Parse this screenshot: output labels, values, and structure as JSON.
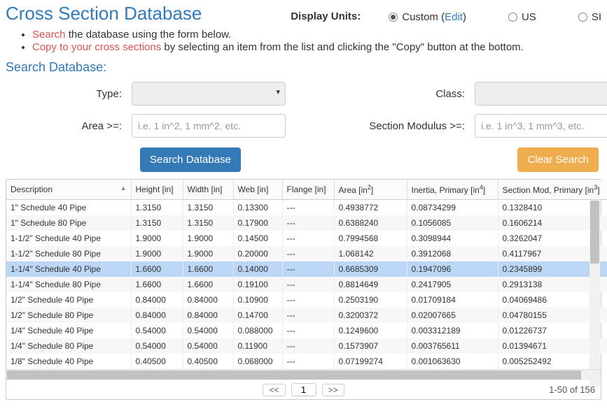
{
  "title": "Cross Section Database",
  "units_label": "Display Units:",
  "units": {
    "custom": "Custom",
    "edit": "Edit",
    "us": "US",
    "si": "SI"
  },
  "instructions": {
    "search_lead": "Search",
    "search_rest": " the database using the form below.",
    "copy_lead": "Copy to your cross sections",
    "copy_rest": " by selecting an item from the list and clicking the \"Copy\" button at the bottom."
  },
  "search_heading": "Search Database:",
  "form": {
    "type_label": "Type:",
    "class_label": "Class:",
    "area_label": "Area >=:",
    "area_placeholder": "i.e. 1 in^2, 1 mm^2, etc.",
    "secmod_label": "Section Modulus >=:",
    "secmod_placeholder": "i.e. 1 in^3, 1 mm^3, etc."
  },
  "buttons": {
    "search": "Search Database",
    "clear": "Clear Search"
  },
  "columns": [
    "Description",
    "Height [in]",
    "Width [in]",
    "Web [in]",
    "Flange [in]",
    "Area [in",
    "Inertia, Primary [in",
    "Section Mod, Primary [in"
  ],
  "col_sup": [
    "",
    "",
    "",
    "",
    "",
    "2",
    "4",
    "3"
  ],
  "rows": [
    {
      "d": "1\" Schedule 40 Pipe",
      "h": "1.3150",
      "w": "1.3150",
      "web": "0.13300",
      "fl": "---",
      "a": "0.4938772",
      "i": "0.08734299",
      "s": "0.1328410"
    },
    {
      "d": "1\" Schedule 80 Pipe",
      "h": "1.3150",
      "w": "1.3150",
      "web": "0.17900",
      "fl": "---",
      "a": "0.6388240",
      "i": "0.1056085",
      "s": "0.1606214"
    },
    {
      "d": "1-1/2\" Schedule 40 Pipe",
      "h": "1.9000",
      "w": "1.9000",
      "web": "0.14500",
      "fl": "---",
      "a": "0.7994568",
      "i": "0.3098944",
      "s": "0.3262047"
    },
    {
      "d": "1-1/2\" Schedule 80 Pipe",
      "h": "1.9000",
      "w": "1.9000",
      "web": "0.20000",
      "fl": "---",
      "a": "1.068142",
      "i": "0.3912068",
      "s": "0.4117967"
    },
    {
      "d": "1-1/4\" Schedule 40 Pipe",
      "h": "1.6600",
      "w": "1.6600",
      "web": "0.14000",
      "fl": "---",
      "a": "0.6685309",
      "i": "0.1947096",
      "s": "0.2345899",
      "sel": true
    },
    {
      "d": "1-1/4\" Schedule 80 Pipe",
      "h": "1.6600",
      "w": "1.6600",
      "web": "0.19100",
      "fl": "---",
      "a": "0.8814649",
      "i": "0.2417905",
      "s": "0.2913138"
    },
    {
      "d": "1/2\" Schedule 40 Pipe",
      "h": "0.84000",
      "w": "0.84000",
      "web": "0.10900",
      "fl": "---",
      "a": "0.2503190",
      "i": "0.01709184",
      "s": "0.04069486"
    },
    {
      "d": "1/2\" Schedule 80 Pipe",
      "h": "0.84000",
      "w": "0.84000",
      "web": "0.14700",
      "fl": "---",
      "a": "0.3200372",
      "i": "0.02007665",
      "s": "0.04780155"
    },
    {
      "d": "1/4\" Schedule 40 Pipe",
      "h": "0.54000",
      "w": "0.54000",
      "web": "0.088000",
      "fl": "---",
      "a": "0.1249600",
      "i": "0.003312189",
      "s": "0.01226737"
    },
    {
      "d": "1/4\" Schedule 80 Pipe",
      "h": "0.54000",
      "w": "0.54000",
      "web": "0.11900",
      "fl": "---",
      "a": "0.1573907",
      "i": "0.003765611",
      "s": "0.01394671"
    },
    {
      "d": "1/8\" Schedule 40 Pipe",
      "h": "0.40500",
      "w": "0.40500",
      "web": "0.068000",
      "fl": "---",
      "a": "0.07199274",
      "i": "0.001063630",
      "s": "0.005252492"
    }
  ],
  "pager": {
    "prev": "<<",
    "next": ">>",
    "page": "1",
    "range": "1-50 of 156"
  }
}
